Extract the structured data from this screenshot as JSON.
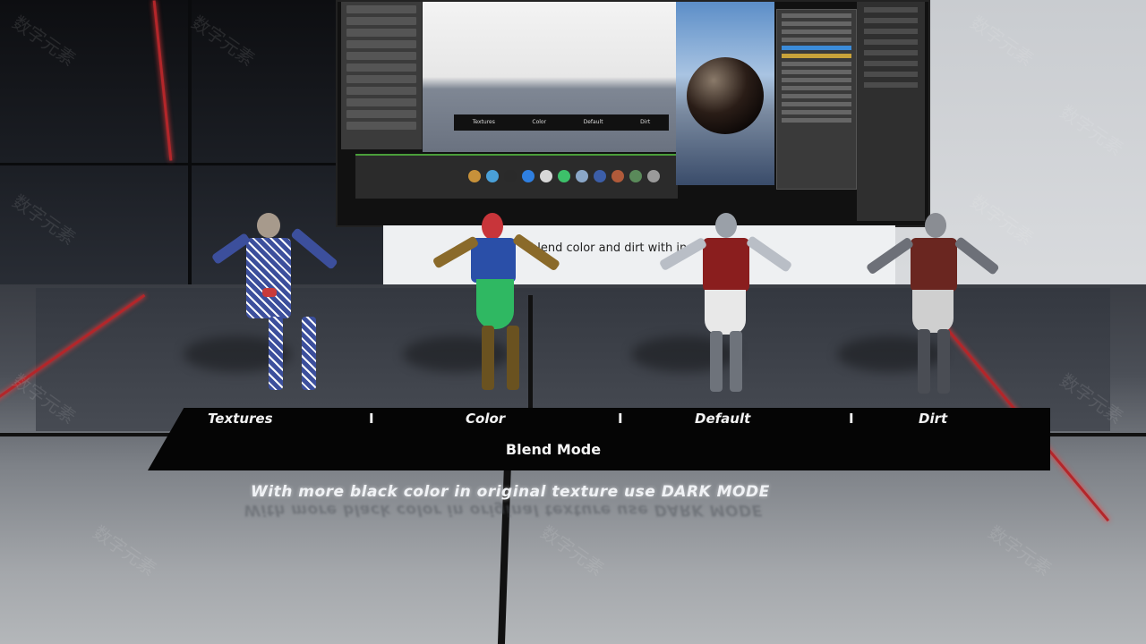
{
  "billboard": {
    "caption": "blend color and dirt with inst"
  },
  "label_plate": {
    "labels": [
      "Textures",
      "Color",
      "Default",
      "Dirt"
    ],
    "separator": "I",
    "title": "Blend Mode"
  },
  "hint": "With more black color in original texture use DARK MODE",
  "characters": [
    {
      "variant": "Textures",
      "colors": {
        "body": "#4a5fa8",
        "accent": "#ffffff",
        "chest": "#c93b3b"
      }
    },
    {
      "variant": "Color",
      "colors": {
        "body": "#2a4fa8",
        "accent": "#2fb862",
        "chest": "#8a6a2a"
      }
    },
    {
      "variant": "Default",
      "colors": {
        "body": "#9aa0a8",
        "accent": "#e8e8e8",
        "chest": "#8a1e1e"
      }
    },
    {
      "variant": "Dirt",
      "colors": {
        "body": "#6d7078",
        "accent": "#d0d0d0",
        "chest": "#6a2620"
      }
    }
  ],
  "watermark": "数字元素",
  "colors": {
    "accent_red": "#b3262a",
    "plate": "#050505"
  }
}
